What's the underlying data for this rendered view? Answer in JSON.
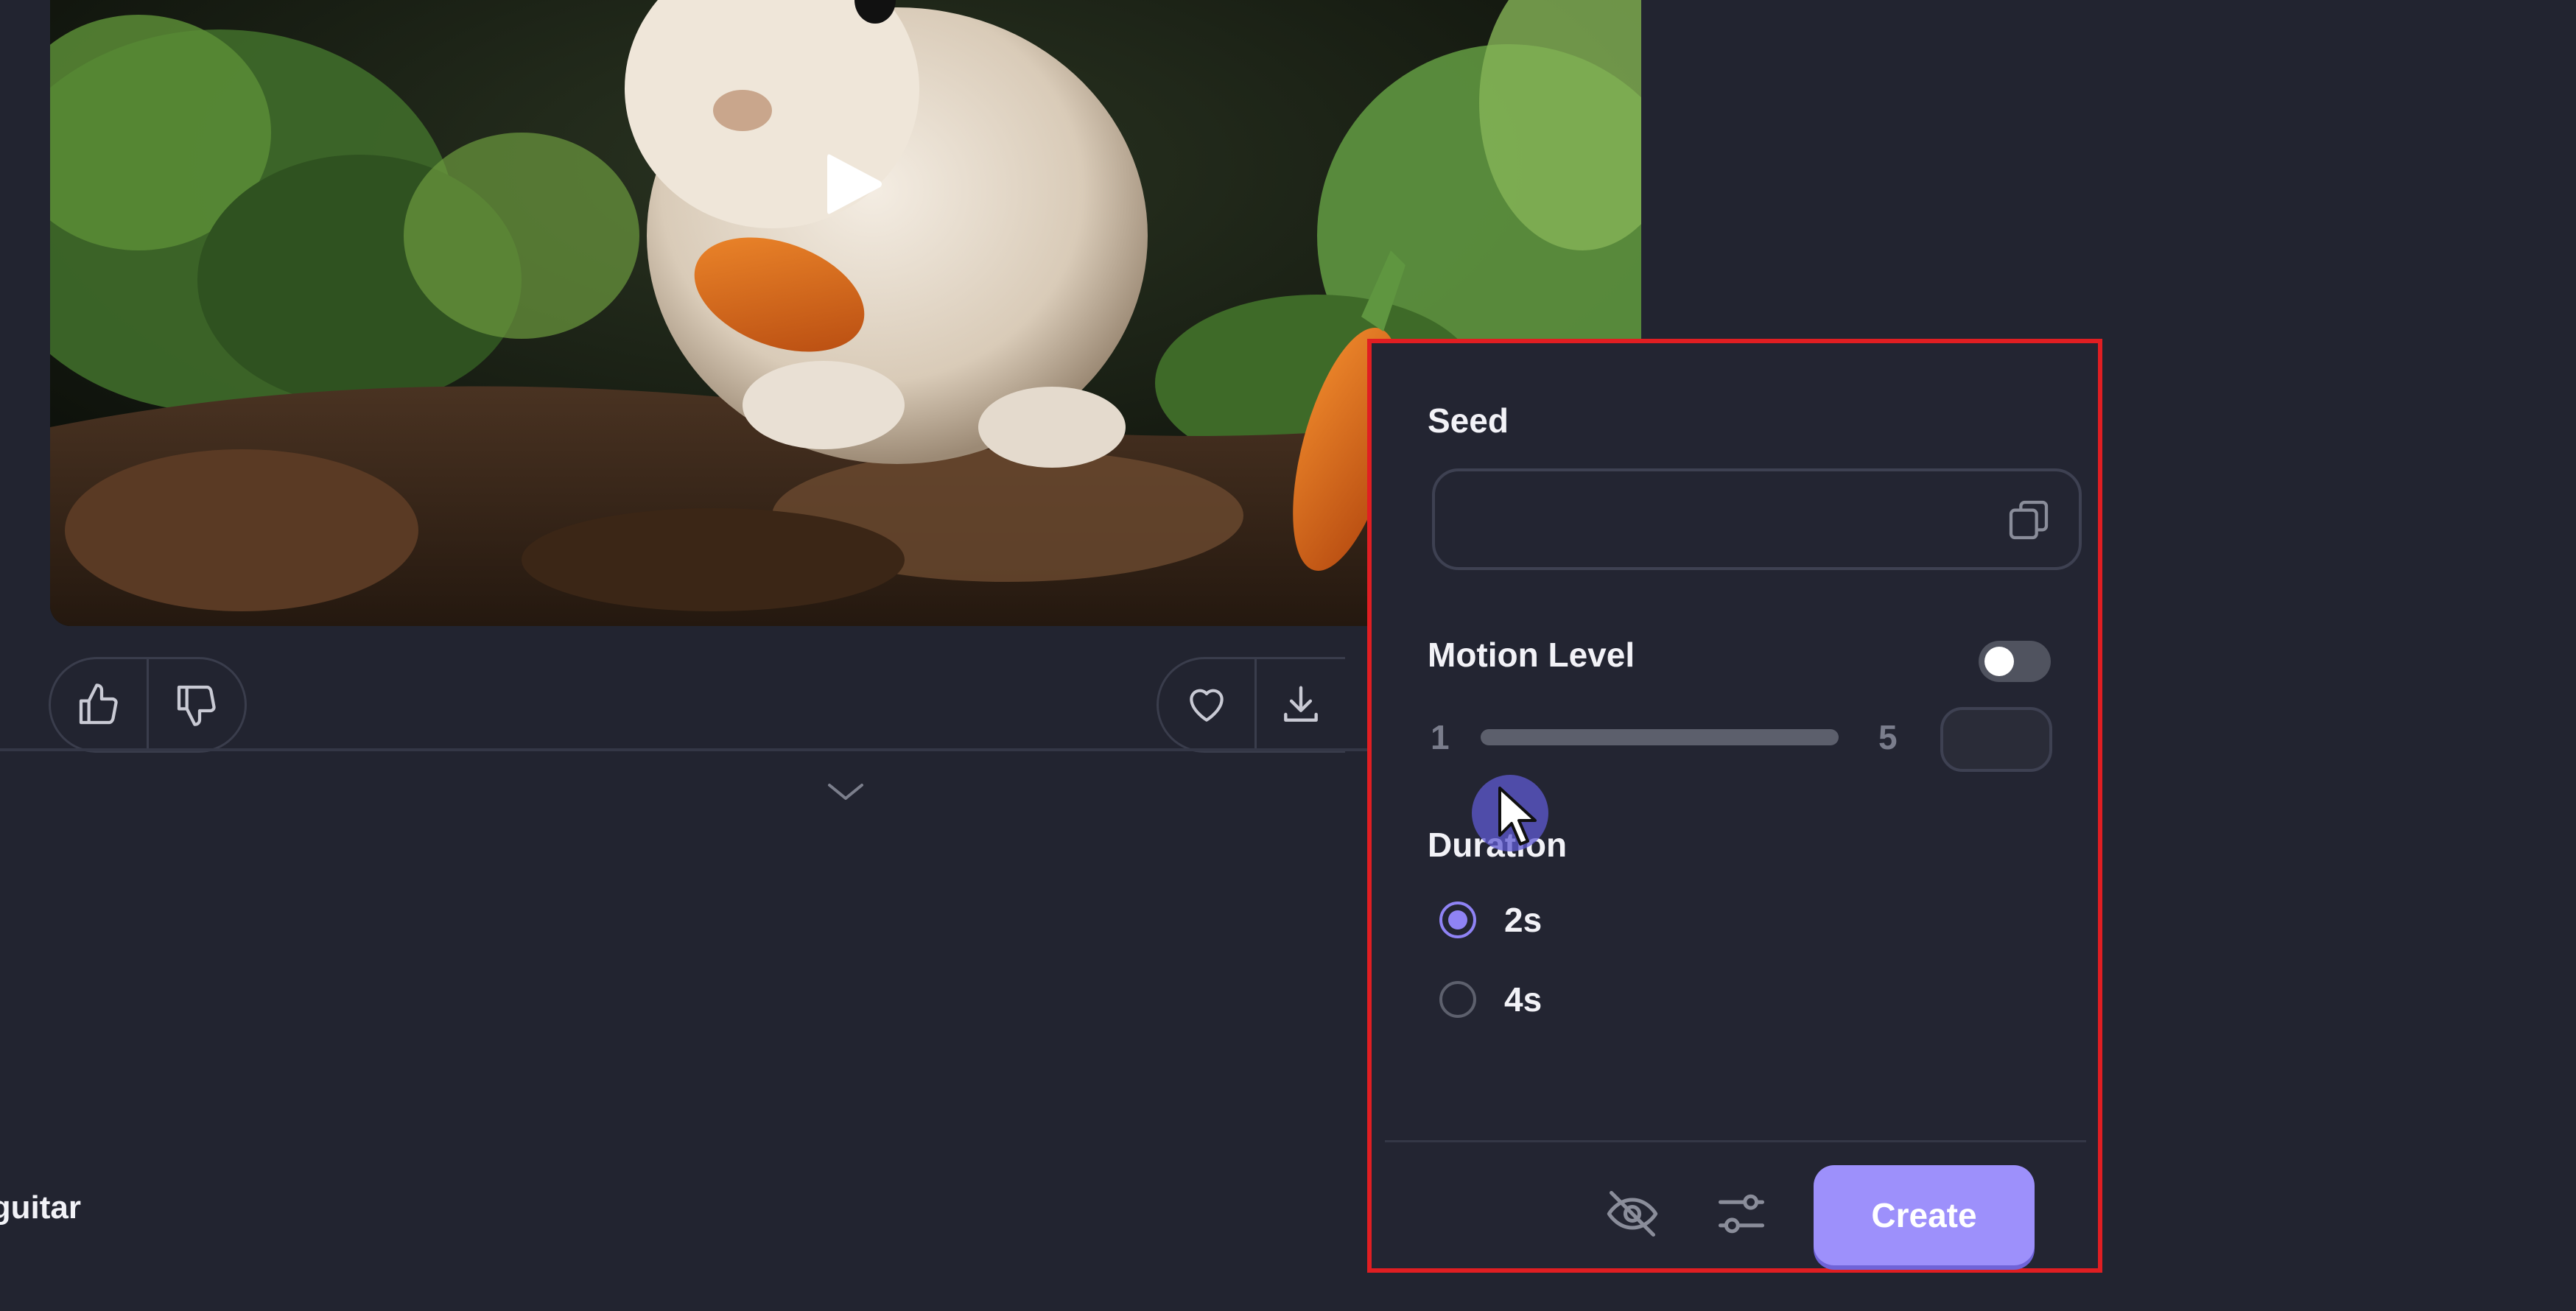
{
  "video": {
    "description_icon": "play-icon"
  },
  "actions": {
    "left_pill": [
      "thumbs-up-icon",
      "thumbs-down-icon"
    ],
    "right_pill": [
      "heart-icon",
      "download-icon"
    ]
  },
  "prompt_snippet": "guitar",
  "settings": {
    "seed": {
      "label": "Seed",
      "value": "",
      "icon": "copy-icon"
    },
    "motion_level": {
      "label": "Motion Level",
      "enabled": false,
      "min_label": "1",
      "max_label": "5",
      "value": ""
    },
    "duration": {
      "label": "Duration",
      "options": [
        {
          "label": "2s",
          "selected": true
        },
        {
          "label": "4s",
          "selected": false
        }
      ]
    },
    "footer": {
      "hide_icon": "eye-off-icon",
      "settings_icon": "sliders-icon",
      "create_label": "Create"
    }
  },
  "colors": {
    "background": "#222430",
    "accent": "#9d90fb",
    "highlight_border": "#e01e22"
  }
}
